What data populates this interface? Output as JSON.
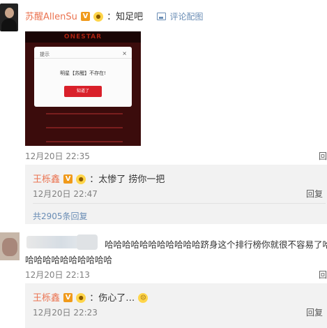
{
  "comment1": {
    "author": "苏醒AllenSu",
    "text": "：知足吧",
    "image_link": "评论配图",
    "time": "12月20日 22:35",
    "action_cut": "回",
    "screenshot": {
      "banner": "ONESTAR",
      "dialog_title": "提示",
      "dialog_close": "×",
      "dialog_message": "明星【苏醒】不存在!",
      "dialog_button": "知道了"
    },
    "reply": {
      "author": "王栎鑫",
      "text": "：太惨了 捞你一把",
      "time": "12月20日 22:47",
      "action": "回复"
    },
    "more_replies": "共2905条回复"
  },
  "comment2": {
    "text_line1": "哈哈哈哈哈哈哈哈哈哈哈跻身这个排行榜你就很不容易了哈",
    "text_line2": "哈哈哈哈哈哈哈哈哈哈",
    "time": "12月20日 22:13",
    "action_cut": "回",
    "reply": {
      "author": "王栎鑫",
      "text": "：伤心了…",
      "time": "12月20日 22:23",
      "action": "回复"
    }
  },
  "badges": {
    "verified": "V"
  },
  "colors": {
    "name": "#eb7350",
    "link": "#6a8db5",
    "button": "#d9202a",
    "badge": "#f09a1b"
  }
}
